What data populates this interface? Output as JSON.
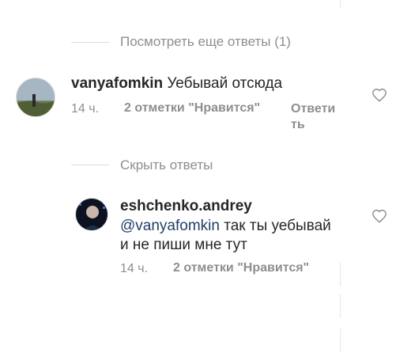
{
  "thread1": {
    "view_more": "Посмотреть еще ответы (1)"
  },
  "comment1": {
    "username": "vanyafomkin",
    "text": "Уебывай отсюда",
    "time": "14 ч.",
    "likes": "2 отметки \"Нравится\"",
    "reply_line1": "Ответи",
    "reply_line2": "ть"
  },
  "thread2": {
    "hide": "Скрыть ответы"
  },
  "reply1": {
    "username": "eshchenko.andrey",
    "mention": "@vanyafomkin",
    "text_line1_rest": " так ты уебывай",
    "text_line2": "и не пиши мне тут",
    "time": "14 ч.",
    "likes": "2 отметки \"Нравится\""
  },
  "icons": {
    "like": "heart-icon"
  },
  "colors": {
    "muted": "#8e8e8e",
    "mention": "#1f3f66",
    "text": "#262626"
  }
}
